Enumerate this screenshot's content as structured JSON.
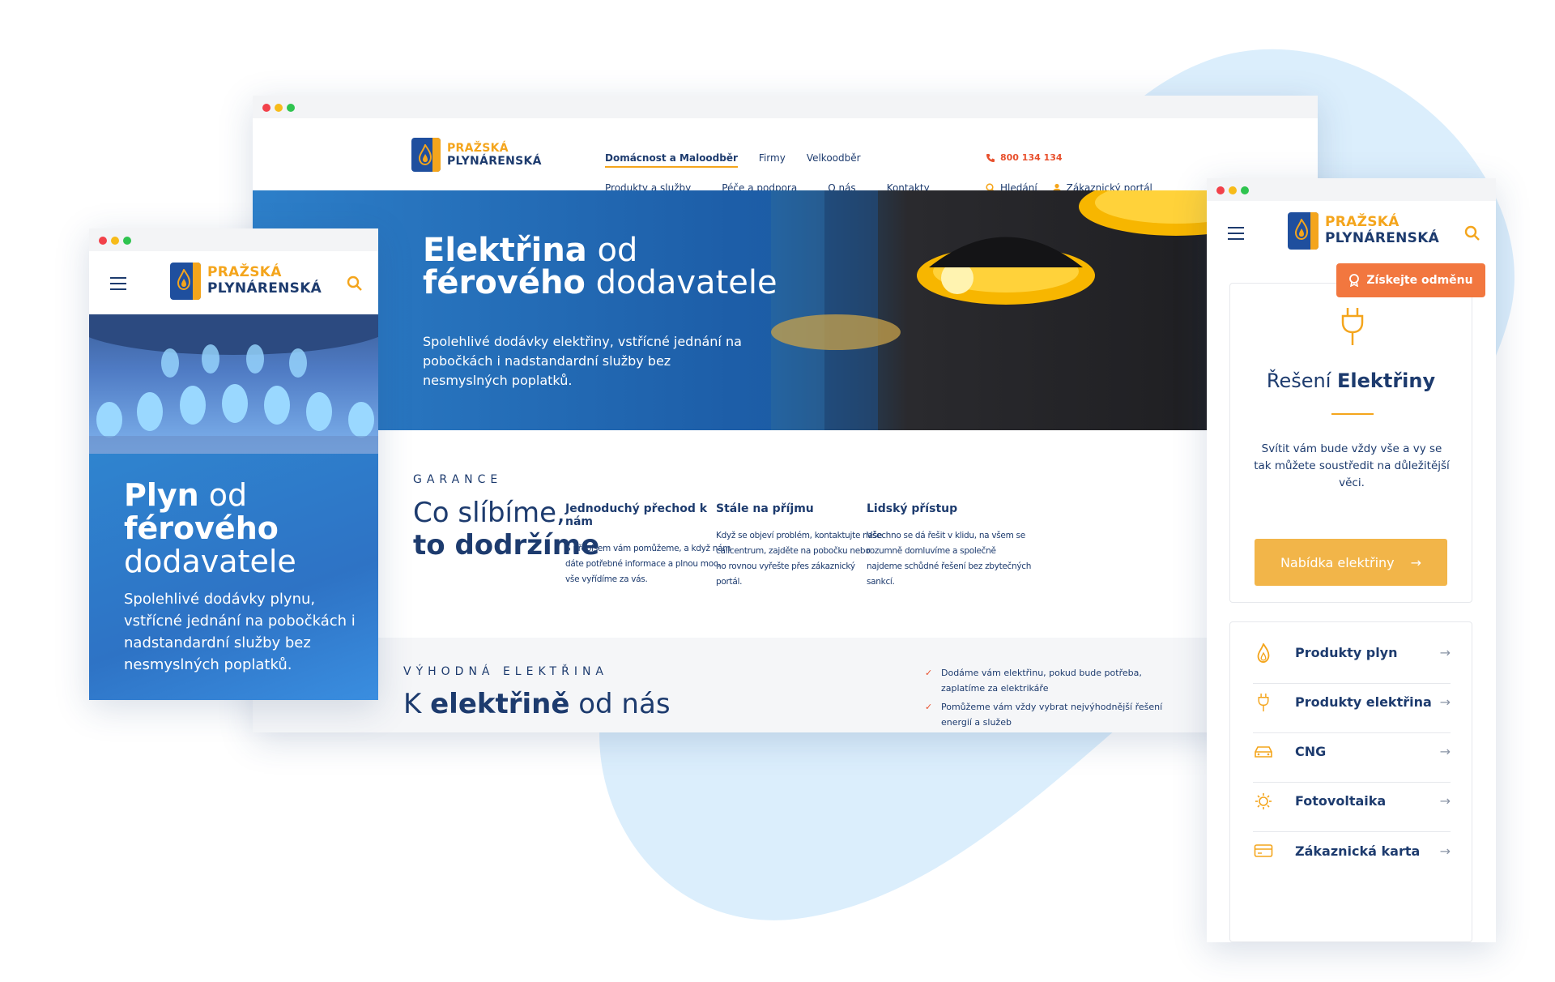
{
  "brand": {
    "line1": "PRAŽSKÁ",
    "line2": "PLYNÁRENSKÁ",
    "orange": "#f4a51c",
    "navy": "#1d3b6e",
    "accent": "#e8502d"
  },
  "desktop": {
    "nav_top": [
      "Domácnost a Maloodběr",
      "Firmy",
      "Velkoodběr"
    ],
    "nav_bottom": [
      "Produkty a služby",
      "Péče a podpora",
      "O nás",
      "Kontakty"
    ],
    "phone": "800 134 134",
    "search_label": "Hledání",
    "portal_label": "Zákaznický portál",
    "hero": {
      "title_bold": "Elektřina",
      "title_rest": " od",
      "title_bold2": "férového",
      "title_rest2": " dodavatele",
      "text": "Spolehlivé dodávky elektřiny, vstřícné jednání na pobočkách i nadstandardní služby bez nesmyslných poplatků."
    },
    "garance": {
      "eyebrow": "GARANCE",
      "title_line1": "Co slíbíme,",
      "title_line2": "to dodržíme",
      "columns": [
        {
          "title": "Jednoduchý přechod k nám",
          "text": "S přepisem vám pomůžeme, a když nám dáte potřebné informace a plnou moc, vše vyřídíme za vás."
        },
        {
          "title": "Stále na příjmu",
          "text": "Když se objeví problém, kontaktujte naše callcentrum, zajděte na pobočku nebo ho rovnou vyřešte přes zákaznický portál."
        },
        {
          "title": "Lidský přístup",
          "text": "Všechno se dá řešit v klidu, na všem se rozumně domluvíme a společně najdeme schůdné řešení bez zbytečných sankcí."
        }
      ]
    },
    "vyhodna": {
      "eyebrow": "VÝHODNÁ ELEKTŘINA",
      "title_pre": "K ",
      "title_bold": "elektřině",
      "title_post": " od nás",
      "checks": [
        "Dodáme vám elektřinu, pokud bude potřeba, zaplatíme za elektrikáře",
        "Pomůžeme vám vždy vybrat nejvýhodnější řešení energií a služeb"
      ]
    }
  },
  "mobile_left": {
    "title_bold": "Plyn",
    "title_rest": " od",
    "title_bold2": "férového",
    "title_rest2": "dodavatele",
    "text": "Spolehlivé dodávky plynu, vstřícné jednání na pobočkách i nadstandardní služby bez nesmyslných poplatků."
  },
  "mobile_right": {
    "reward_label": "Získejte odměnu",
    "card_title_pre": "Řešení ",
    "card_title_bold": "Elektřiny",
    "card_text": "Svítit vám bude vždy vše a vy se tak můžete soustředit na důležitější věci.",
    "cta_label": "Nabídka elektřiny",
    "products": [
      {
        "label": "Produkty plyn",
        "icon": "flame-icon"
      },
      {
        "label": "Produkty elektřina",
        "icon": "plug-icon"
      },
      {
        "label": "CNG",
        "icon": "car-icon"
      },
      {
        "label": "Fotovoltaika",
        "icon": "sun-icon"
      },
      {
        "label": "Zákaznická karta",
        "icon": "card-icon"
      }
    ]
  }
}
